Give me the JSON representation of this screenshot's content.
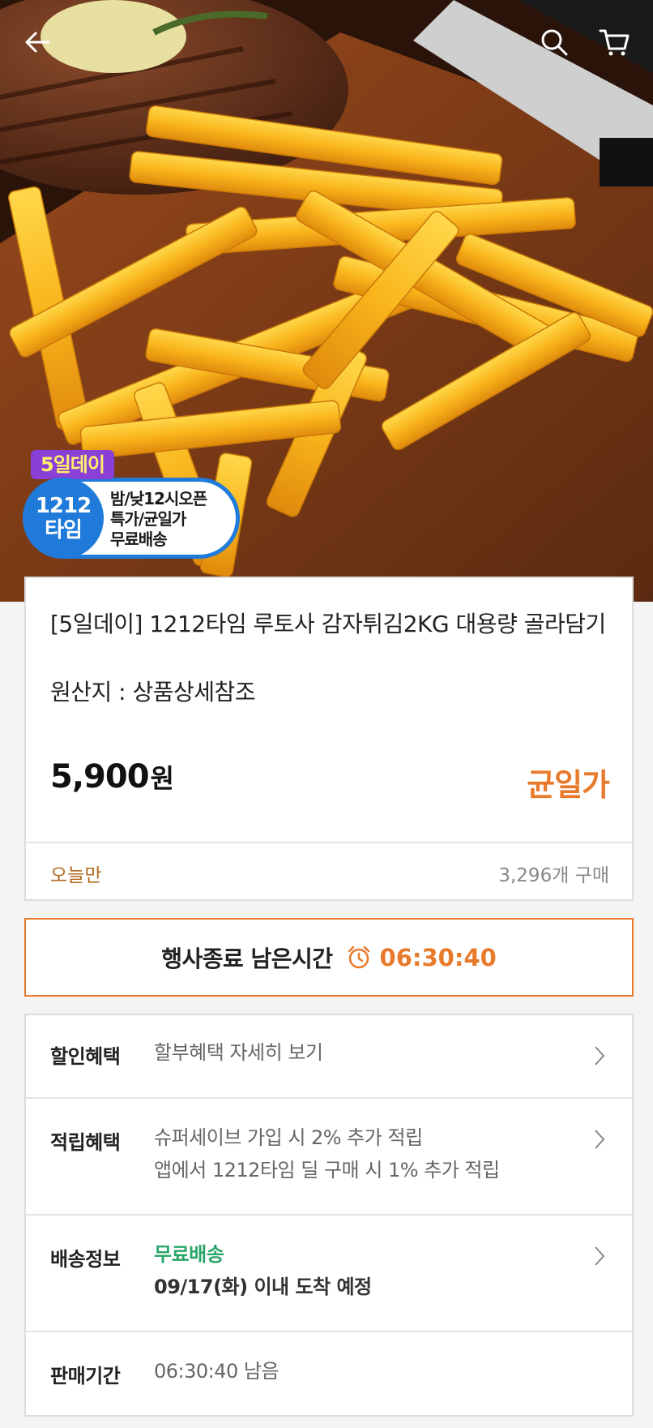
{
  "header": {
    "back_icon": "arrow-left-icon",
    "search_icon": "search-icon",
    "cart_icon": "cart-icon"
  },
  "badge": {
    "top": "5일데이",
    "circle_line1": "1212",
    "circle_line2": "타임",
    "line1": "밤/낮12시오픈",
    "line2": "특가/균일가",
    "line3": "무료배송"
  },
  "product": {
    "title": "[5일데이] 1212타임 루토사 감자튀김2KG 대용량 골라담기",
    "origin": "원산지 : 상품상세참조",
    "price": "5,900",
    "price_unit": "원",
    "price_tag": "균일가",
    "today_label": "오늘만",
    "buy_count": "3,296개 구매"
  },
  "timer": {
    "label": "행사종료 남은시간",
    "value": "06:30:40",
    "icon": "alarm-clock-icon"
  },
  "details": {
    "discount": {
      "label": "할인혜택",
      "text": "할부혜택 자세히 보기"
    },
    "points": {
      "label": "적립혜택",
      "line1": "슈퍼세이브 가입 시 2% 추가 적립",
      "line2": "앱에서 1212타임 딜 구매 시 1% 추가 적립"
    },
    "shipping": {
      "label": "배송정보",
      "free": "무료배송",
      "date": "09/17(화)",
      "date_suffix": " 이내 도착 예정"
    },
    "period": {
      "label": "판매기간",
      "text": "06:30:40 남음"
    }
  },
  "colors": {
    "accent": "#e87a2b",
    "free_shipping": "#2aa56a",
    "badge_blue": "#1f7ad9",
    "badge_purple": "#8a3fd6"
  }
}
